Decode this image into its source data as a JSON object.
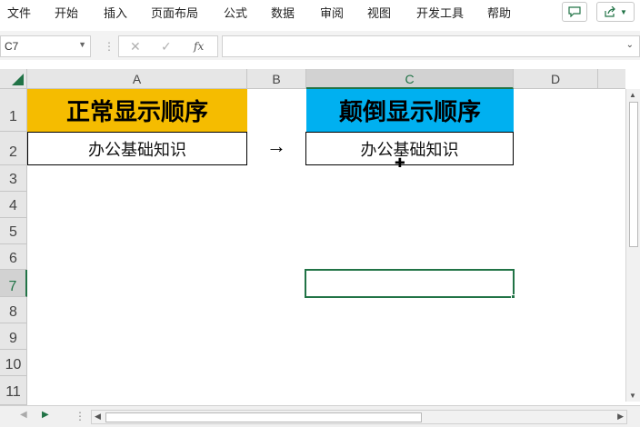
{
  "menu": {
    "items": [
      "文件",
      "开始",
      "插入",
      "页面布局",
      "公式",
      "数据",
      "审阅",
      "视图",
      "开发工具",
      "帮助"
    ]
  },
  "formula_bar": {
    "name_box": "C7",
    "formula": ""
  },
  "columns": [
    "A",
    "B",
    "C",
    "D"
  ],
  "rows": [
    "1",
    "2",
    "3",
    "4",
    "5",
    "6",
    "7",
    "8",
    "9",
    "10",
    "11"
  ],
  "cells": {
    "A1": "正常显示顺序",
    "C1": "颠倒显示顺序",
    "A2": "办公基础知识",
    "C2": "办公基础知识",
    "B2": "→"
  },
  "colors": {
    "accent": "#217346",
    "a1_fill": "#f5bc00",
    "c1_fill": "#00b0f0"
  },
  "selected_cell": "C7"
}
